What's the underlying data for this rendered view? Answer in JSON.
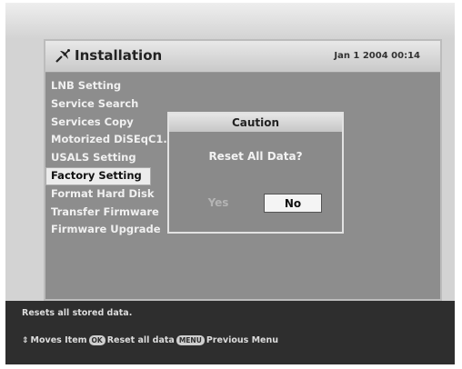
{
  "window": {
    "title": "Installation",
    "datetime": "Jan 1 2004 00:14",
    "icon": "satellite-dish-icon"
  },
  "menu": {
    "items": [
      {
        "label": "LNB Setting"
      },
      {
        "label": "Service Search"
      },
      {
        "label": "Services Copy"
      },
      {
        "label": "Motorized DiSEqC1.2"
      },
      {
        "label": "USALS Setting"
      },
      {
        "label": "Factory Setting"
      },
      {
        "label": "Format Hard Disk"
      },
      {
        "label": "Transfer Firmware"
      },
      {
        "label": "Firmware Upgrade"
      }
    ],
    "selected": "Factory Setting"
  },
  "dialog": {
    "title": "Caution",
    "message": "Reset All Data?",
    "yes_label": "Yes",
    "no_label": "No",
    "focused": "No"
  },
  "footer": {
    "hint": "Resets all stored data.",
    "key_moves": "Moves Item",
    "ok_key": "OK",
    "ok_action": "Reset all data",
    "menu_key": "MENU",
    "menu_action": "Previous Menu"
  },
  "colors": {
    "panel": "#8d8d8d",
    "footer": "#2e2e2e",
    "selection": "#ececec"
  }
}
